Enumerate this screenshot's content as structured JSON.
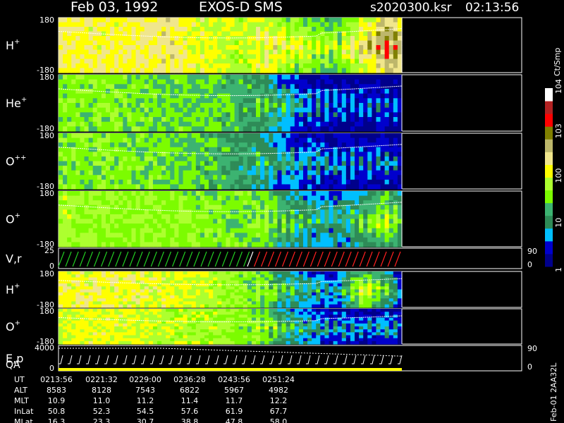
{
  "header": {
    "date": "Feb 03, 1992",
    "instrument": "EXOS-D SMS",
    "file": "s2020300.ksr",
    "time": "02:13:56"
  },
  "colorbar": {
    "units": "Ct/Smp",
    "ticks": [
      "1",
      "10",
      "100",
      "10^3",
      "10^4"
    ],
    "colors": [
      "#00008b",
      "#0000cd",
      "#00bfff",
      "#2e8b57",
      "#3cb371",
      "#7cfc00",
      "#adff2f",
      "#ffff00",
      "#f0e68c",
      "#bdb76b",
      "#808000",
      "#ff0000",
      "#b22222",
      "#ffffff"
    ]
  },
  "chart_data": [
    {
      "type": "heatmap",
      "panel_label": "H+",
      "ylim": [
        -180,
        180
      ],
      "ytick_labels": [
        "180",
        "-180"
      ],
      "intensity_profile": {
        "x_fraction": [
          0,
          0.15,
          0.3,
          0.45,
          0.55,
          0.62,
          0.7,
          0.8,
          0.88,
          0.95,
          1.0
        ],
        "log_counts": [
          2.3,
          2.2,
          2.4,
          2.0,
          1.9,
          2.0,
          1.8,
          1.6,
          2.2,
          2.8,
          2.5
        ]
      }
    },
    {
      "type": "heatmap",
      "panel_label": "He+",
      "ylim": [
        -180,
        180
      ],
      "ytick_labels": [
        "180",
        "-180"
      ],
      "intensity_profile": {
        "x_fraction": [
          0,
          0.15,
          0.3,
          0.45,
          0.55,
          0.62,
          0.7,
          0.8,
          0.88,
          0.95,
          1.0
        ],
        "log_counts": [
          1.6,
          1.6,
          1.5,
          1.4,
          1.2,
          1.0,
          0.6,
          0.4,
          0.3,
          0.4,
          0.3
        ]
      }
    },
    {
      "type": "heatmap",
      "panel_label": "O++",
      "ylim": [
        -180,
        180
      ],
      "ytick_labels": [
        "180",
        "-180"
      ],
      "intensity_profile": {
        "x_fraction": [
          0,
          0.15,
          0.3,
          0.45,
          0.55,
          0.62,
          0.7,
          0.8,
          0.88,
          0.95,
          1.0
        ],
        "log_counts": [
          1.6,
          1.6,
          1.5,
          1.3,
          1.0,
          0.8,
          0.6,
          0.5,
          0.4,
          0.5,
          0.4
        ]
      }
    },
    {
      "type": "heatmap",
      "panel_label": "O+",
      "ylim": [
        -180,
        180
      ],
      "ytick_labels": [
        "180",
        "-180"
      ],
      "intensity_profile": {
        "x_fraction": [
          0,
          0.15,
          0.3,
          0.45,
          0.55,
          0.62,
          0.7,
          0.8,
          0.88,
          0.95,
          1.0
        ],
        "log_counts": [
          1.8,
          1.7,
          1.7,
          1.6,
          1.5,
          1.4,
          1.0,
          0.8,
          1.2,
          1.6,
          1.2
        ]
      }
    },
    {
      "type": "line",
      "panel_label": "V,r",
      "ylim": [
        0,
        25
      ],
      "ytick_labels": [
        "25",
        "0"
      ],
      "right_ylim": [
        0,
        90
      ],
      "right_tick_labels": [
        "90",
        "0"
      ],
      "series": [
        {
          "color": "#22cc22",
          "x_fraction_range": [
            0.0,
            0.56
          ]
        },
        {
          "color": "#ffffff",
          "x_fraction_range": [
            0.55,
            0.57
          ]
        },
        {
          "color": "#ff2020",
          "x_fraction_range": [
            0.57,
            1.0
          ]
        }
      ]
    },
    {
      "type": "heatmap",
      "panel_label": "H+",
      "ylim": [
        -180,
        180
      ],
      "ytick_labels": [
        "180",
        "-180"
      ],
      "intensity_profile": {
        "x_fraction": [
          0,
          0.15,
          0.3,
          0.45,
          0.55,
          0.62,
          0.7,
          0.8,
          0.88,
          0.95,
          1.0
        ],
        "log_counts": [
          2.2,
          2.2,
          2.1,
          1.9,
          1.6,
          1.3,
          0.9,
          0.6,
          1.8,
          1.2,
          0.4
        ]
      }
    },
    {
      "type": "heatmap",
      "panel_label": "O+",
      "ylim": [
        -180,
        180
      ],
      "ytick_labels": [
        "180",
        "-180"
      ],
      "intensity_profile": {
        "x_fraction": [
          0,
          0.15,
          0.3,
          0.45,
          0.55,
          0.62,
          0.7,
          0.8,
          0.88,
          0.95,
          1.0
        ],
        "log_counts": [
          2.0,
          2.1,
          1.9,
          1.8,
          1.6,
          1.3,
          0.9,
          0.6,
          0.5,
          0.6,
          0.4
        ]
      }
    },
    {
      "type": "line",
      "panel_label": "E,p",
      "panel_label_2": "QA",
      "ylim": [
        0,
        4000
      ],
      "ytick_labels": [
        "4000",
        "0"
      ],
      "right_ylim": [
        0,
        90
      ],
      "right_tick_labels": [
        "90",
        "0"
      ]
    }
  ],
  "ephemeris": {
    "row_labels": [
      "UT",
      "ALT",
      "MLT",
      "InLat",
      "MLat"
    ],
    "columns": [
      {
        "UT": "0213:56",
        "ALT": "8583",
        "MLT": "10.9",
        "InLat": "50.8",
        "MLat": "16.3"
      },
      {
        "UT": "0221:32",
        "ALT": "8128",
        "MLT": "11.0",
        "InLat": "52.3",
        "MLat": "23.3"
      },
      {
        "UT": "0229:00",
        "ALT": "7543",
        "MLT": "11.2",
        "InLat": "54.5",
        "MLat": "30.7"
      },
      {
        "UT": "0236:28",
        "ALT": "6822",
        "MLT": "11.4",
        "InLat": "57.6",
        "MLat": "38.8"
      },
      {
        "UT": "0243:56",
        "ALT": "5967",
        "MLT": "11.7",
        "InLat": "61.9",
        "MLat": "47.8"
      },
      {
        "UT": "0251:24",
        "ALT": "4982",
        "MLT": "12.2",
        "InLat": "67.7",
        "MLat": "58.0"
      }
    ]
  },
  "footer_code": "Feb-01 2AA32L"
}
